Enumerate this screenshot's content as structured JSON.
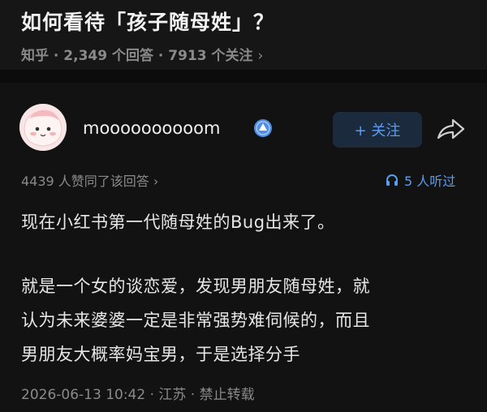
{
  "question": {
    "title": "如何看待「孩子随母姓」？",
    "meta": "知乎 · 2,349 个回答 · 7913 个关注",
    "meta_chevron": "›"
  },
  "answer": {
    "author": "moooooooooom",
    "follow_label": "+ 关注",
    "stats": "4439 人赞同了该回答 ›",
    "listen_label": "5 人听过",
    "paragraph1": "现在小红书第一代随母姓的Bug出来了。",
    "paragraph2_lines": [
      "就是一个女的谈恋爱，发现男朋友随母姓，就",
      "认为未来婆婆一定是非常强势难伺候的，而且",
      "男朋友大概率妈宝男，于是选择分手"
    ],
    "footer": "2026-06-13 10:42 · 江苏 · 禁止转载"
  },
  "icons": {
    "badge": "verified-badge-icon",
    "share": "share-arrow-icon",
    "listen": "headphones-icon",
    "avatar": "pink-cartoon-avatar"
  },
  "colors": {
    "background": "#121212",
    "accent": "#5a9df0",
    "muted": "#8a8a8a",
    "text": "#e6e6e6"
  }
}
